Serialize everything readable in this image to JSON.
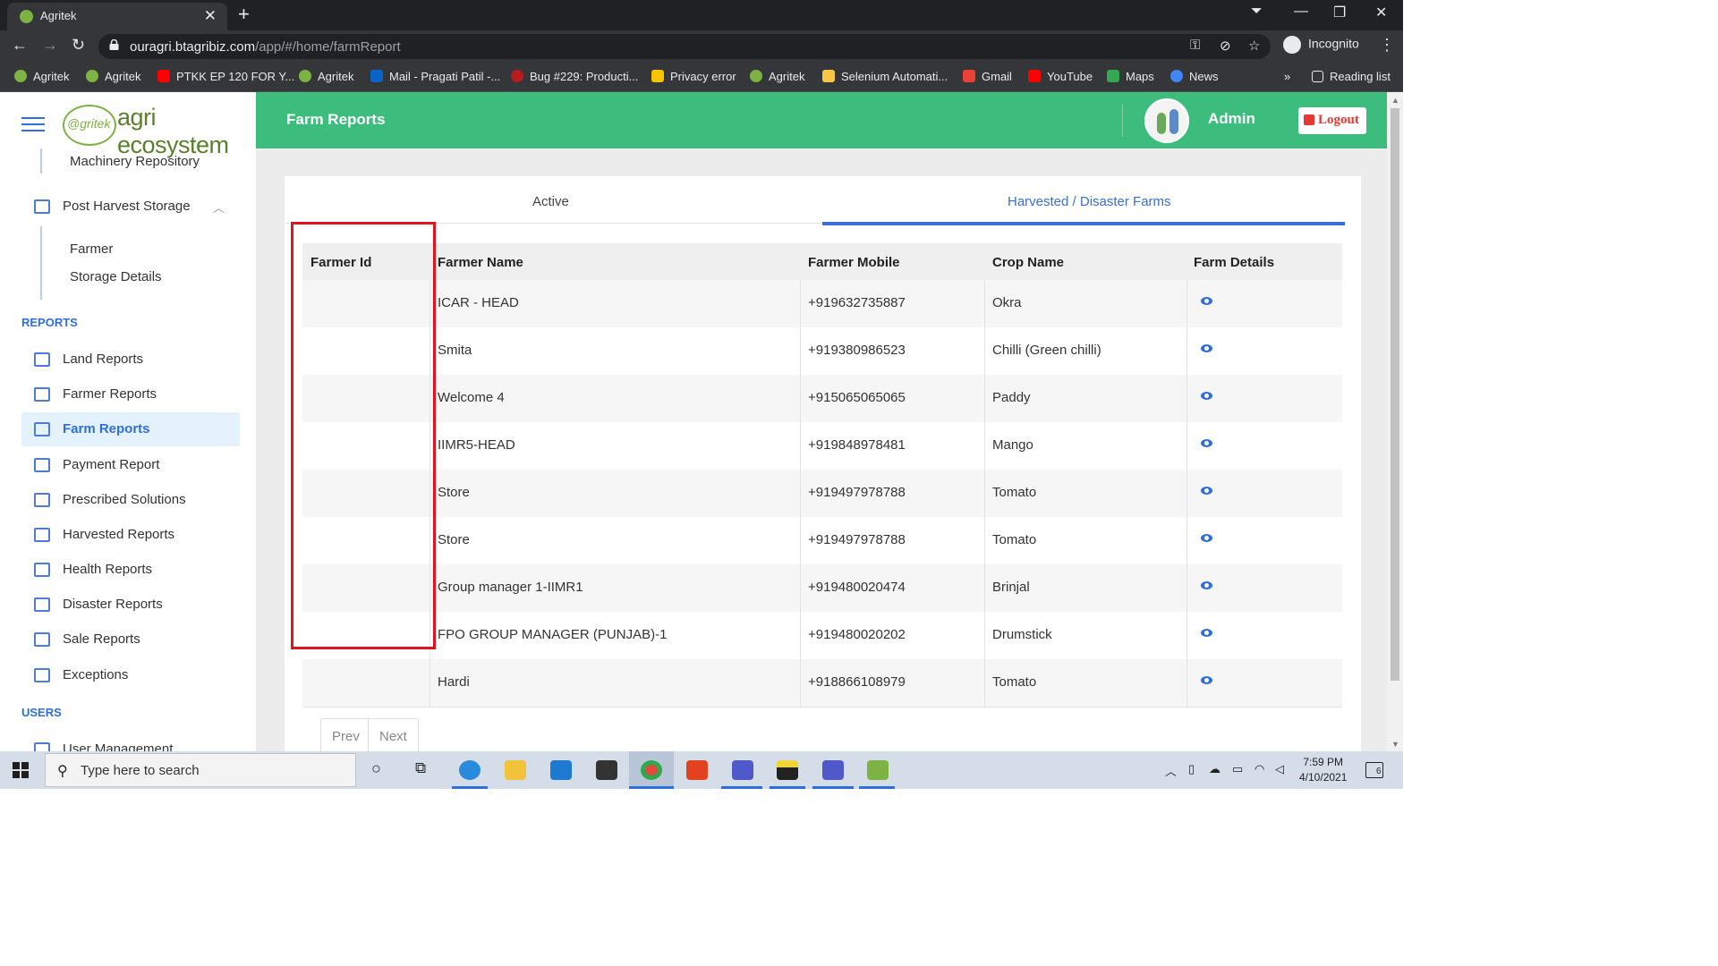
{
  "browser": {
    "tab_title": "Agritek",
    "url_host": "ouragri.btagribiz.com",
    "url_path": "/app/#/home/farmReport",
    "profile": "Incognito",
    "bookmarks": [
      "Agritek",
      "Agritek",
      "PTKK EP 120 FOR Y...",
      "Agritek",
      "Mail - Pragati Patil -...",
      "Bug #229: Producti...",
      "Privacy error",
      "Agritek",
      "Selenium Automati...",
      "Gmail",
      "YouTube",
      "Maps",
      "News"
    ],
    "more_bookmarks": "»",
    "reading_list": "Reading list"
  },
  "sidebar": {
    "logo_prefix": "@gritek",
    "logo_text": "agri ecosystem",
    "machinery": "Machinery Repository",
    "post_harvest": "Post Harvest Storage",
    "post_harvest_sub": [
      "Farmer",
      "Storage Details"
    ],
    "reports_heading": "REPORTS",
    "reports": [
      "Land Reports",
      "Farmer Reports",
      "Farm Reports",
      "Payment Report",
      "Prescribed Solutions",
      "Harvested Reports",
      "Health Reports",
      "Disaster Reports",
      "Sale Reports",
      "Exceptions"
    ],
    "active_report": "Farm Reports",
    "users_heading": "USERS",
    "user_mgmt": "User Management"
  },
  "header": {
    "title": "Farm Reports",
    "user": "Admin",
    "logout": "Logout"
  },
  "tabs": {
    "active": "Active",
    "harvested": "Harvested / Disaster Farms",
    "selected": "Harvested / Disaster Farms"
  },
  "table": {
    "columns": [
      "Farmer Id",
      "Farmer Name",
      "Farmer Mobile",
      "Crop Name",
      "Farm Details"
    ],
    "rows": [
      {
        "id": "",
        "name": "ICAR - HEAD",
        "mobile": "+919632735887",
        "crop": "Okra"
      },
      {
        "id": "",
        "name": "Smita",
        "mobile": "+919380986523",
        "crop": "Chilli (Green chilli)"
      },
      {
        "id": "",
        "name": "Welcome 4",
        "mobile": "+915065065065",
        "crop": "Paddy"
      },
      {
        "id": "",
        "name": "IIMR5-HEAD",
        "mobile": "+919848978481",
        "crop": "Mango"
      },
      {
        "id": "",
        "name": "Store",
        "mobile": "+919497978788",
        "crop": "Tomato"
      },
      {
        "id": "",
        "name": "Store",
        "mobile": "+919497978788",
        "crop": "Tomato"
      },
      {
        "id": "",
        "name": "Group manager 1-IIMR1",
        "mobile": "+919480020474",
        "crop": "Brinjal"
      },
      {
        "id": "",
        "name": "FPO GROUP MANAGER (PUNJAB)-1",
        "mobile": "+919480020202",
        "crop": "Drumstick"
      },
      {
        "id": "",
        "name": "Hardi",
        "mobile": "+918866108979",
        "crop": "Tomato"
      }
    ]
  },
  "pager": {
    "prev": "Prev",
    "next": "Next"
  },
  "taskbar": {
    "search_placeholder": "Type here to search",
    "time": "7:59 PM",
    "date": "4/10/2021",
    "notifications": "6"
  },
  "colors": {
    "header_green": "#3dbd7d",
    "accent_blue": "#2f6fdd",
    "highlight_red": "#e0141e",
    "logout_red": "#e53935"
  }
}
